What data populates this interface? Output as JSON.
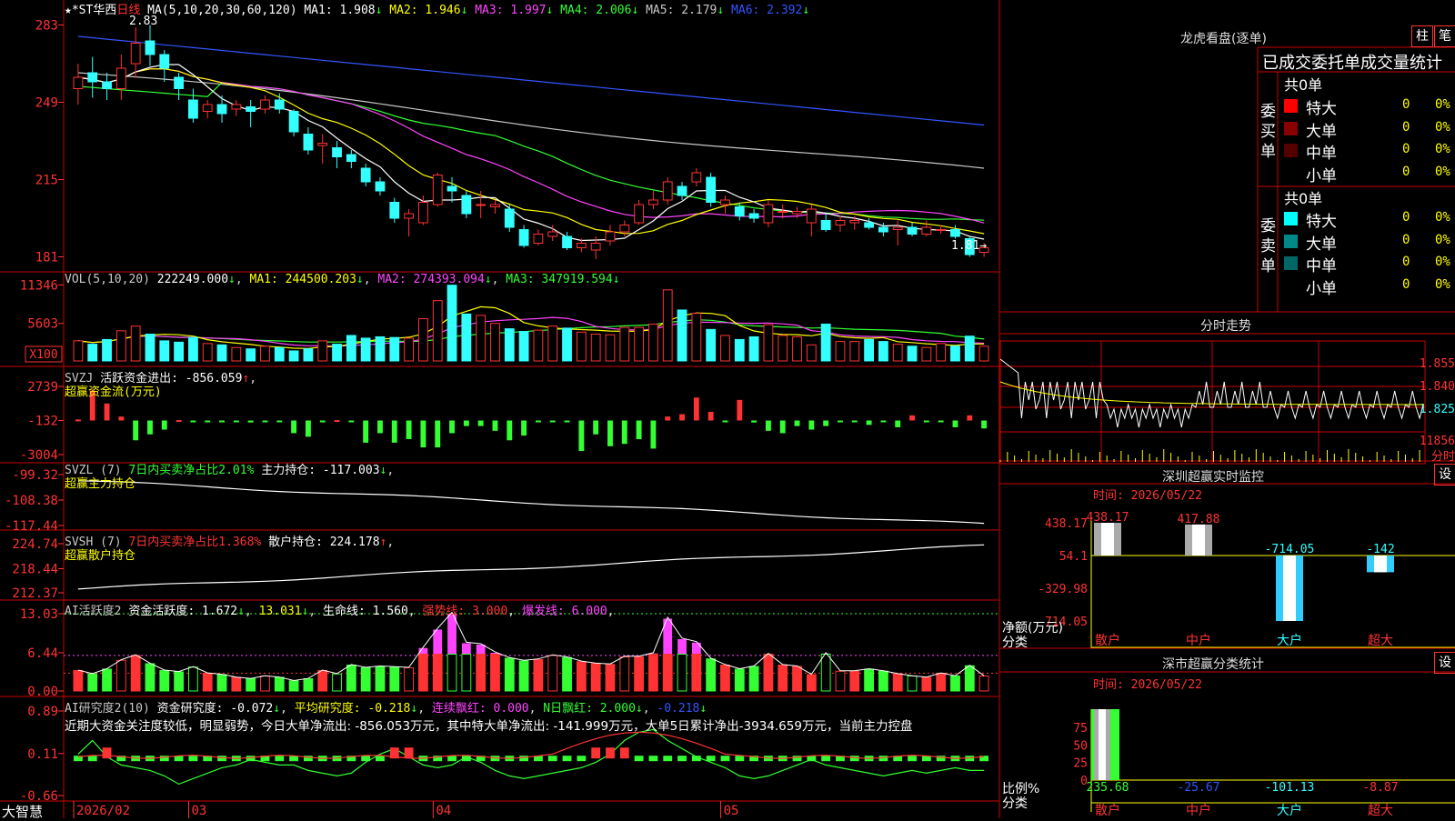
{
  "stock": {
    "name": "★*ST华西",
    "period": "日线",
    "ma_header": "MA(5,10,20,30,60,120)",
    "ma_values": [
      {
        "label": "MA1:",
        "value": "1.908",
        "arrow": "↓",
        "color": "#ffffff"
      },
      {
        "label": "MA2:",
        "value": "1.946",
        "arrow": "↓",
        "color": "#ffff00"
      },
      {
        "label": "MA3:",
        "value": "1.997",
        "arrow": "↓",
        "color": "#ff44ff"
      },
      {
        "label": "MA4:",
        "value": "2.006",
        "arrow": "↓",
        "color": "#33ff33"
      },
      {
        "label": "MA5:",
        "value": "2.179",
        "arrow": "↓",
        "color": "#c8c8c8"
      },
      {
        "label": "MA6:",
        "value": "2.392",
        "arrow": "↓",
        "color": "#3355ff"
      }
    ],
    "high_marker": "2.83",
    "low_marker": "1.81→",
    "price_ticks": [
      "283",
      "249",
      "215",
      "181"
    ]
  },
  "vol": {
    "header": "VOL(5,10,20)",
    "value": "222249.000",
    "ma1": "MA1: 244500.203",
    "ma2": "MA2: 274393.094",
    "ma3": "MA3: 347919.594",
    "ticks": [
      "11346",
      "5603",
      "X100"
    ]
  },
  "svzj": {
    "header": "SVZJ",
    "label": "活跃资金进出: -856.059",
    "sub": "超赢资金流(万元)",
    "ticks": [
      "2739",
      "-132",
      "-3004"
    ]
  },
  "svzl": {
    "header": "SVZL (7)",
    "text1": "7日内买卖净占比2.01%",
    "text2": "主力持仓: -117.003",
    "sub": "超赢主力持仓",
    "ticks": [
      "-99.32",
      "-108.38",
      "-117.44"
    ]
  },
  "svsh": {
    "header": "SVSH (7)",
    "text1": "7日内买卖净占比1.368%",
    "text2": "散户持仓: 224.178",
    "sub": "超赢散户持仓",
    "ticks": [
      "224.74",
      "218.44",
      "212.37"
    ]
  },
  "ai1": {
    "header": "AI活跃度2",
    "label": "资金活跃度: 1.672",
    "v1": "13.031",
    "v2": "生命线: 1.560",
    "v3": "强势线: 3.000",
    "v4": "爆发线: 6.000",
    "ticks": [
      "13.03",
      "6.44",
      "0.00"
    ]
  },
  "ai2": {
    "header": "AI研究度2(10)",
    "label": "资金研究度: -0.072",
    "avg": "平均研究度: -0.218",
    "cont": "连续飘红: 0.000",
    "nday": "N日飘红: 2.000",
    "last": "-0.218",
    "comment": "近期大资金关注度较低，明显弱势，今日大单净流出: -856.053万元，其中特大单净流出: -141.999万元，大单5日累计净出-3934.659万元，当前主力控盘",
    "ticks": [
      "0.89",
      "0.11",
      "-0.66"
    ]
  },
  "xaxis": {
    "labels": [
      "2026/02",
      "03",
      "04",
      "05"
    ]
  },
  "brand": "大智慧",
  "right": {
    "dragon_title": "龙虎看盘(逐单)",
    "btn1": "柱",
    "btn2": "笔",
    "subtitle": "已成交委托单成交量统计",
    "buy_side_label": "委买单",
    "sell_side_label": "委卖单",
    "buy_total": "共0单",
    "sell_total": "共0单",
    "buy_rows": [
      {
        "name": "特大",
        "value": "0",
        "pct": "0%",
        "color": "#ff0000"
      },
      {
        "name": "大单",
        "value": "0",
        "pct": "0%",
        "color": "#880000"
      },
      {
        "name": "中单",
        "value": "0",
        "pct": "0%",
        "color": "#550000"
      },
      {
        "name": "小单",
        "value": "0",
        "pct": "0%",
        "color": ""
      }
    ],
    "sell_rows": [
      {
        "name": "特大",
        "value": "0",
        "pct": "0%",
        "color": "#00ffff"
      },
      {
        "name": "大单",
        "value": "0",
        "pct": "0%",
        "color": "#008888"
      },
      {
        "name": "中单",
        "value": "0",
        "pct": "0%",
        "color": "#006666"
      },
      {
        "name": "小单",
        "value": "0",
        "pct": "0%",
        "color": ""
      }
    ],
    "intraday_title": "分时走势",
    "intraday_ticks": [
      "1.855",
      "1.840",
      "1.825",
      "11856",
      "分时"
    ],
    "sz_title": "深圳超赢实时监控",
    "sz_btn": "设",
    "sz_time": "时间: 2026/05/22",
    "sz_ticks": [
      "438.17",
      "54.1",
      "-329.98",
      "-714.05"
    ],
    "sz_unit": "净额(万元)",
    "sz_cat_label": "分类",
    "sz_bars": [
      {
        "cat": "散户",
        "value": 438.17,
        "label": "438.17",
        "lcolor": "#ff3333"
      },
      {
        "cat": "中户",
        "value": 417.88,
        "label": "417.88",
        "lcolor": "#ff3333"
      },
      {
        "cat": "大户",
        "value": -714.05,
        "label": "-714.05",
        "lcolor": "#33ffff"
      },
      {
        "cat": "超大",
        "value": -142,
        "label": "-142",
        "lcolor": "#33ffff"
      }
    ],
    "sc_title": "深市超赢分类统计",
    "sc_btn": "设",
    "sc_time": "时间: 2026/05/22",
    "sc_ticks": [
      "75",
      "50",
      "25",
      "0"
    ],
    "sc_unit": "比例%",
    "sc_cat_label": "分类",
    "sc_bars": [
      {
        "cat": "散户",
        "value": 235.68,
        "label": "235.68",
        "lcolor": "#33ff33"
      },
      {
        "cat": "中户",
        "value": -25.67,
        "label": "-25.67",
        "lcolor": "#3355ff"
      },
      {
        "cat": "大户",
        "value": -101.13,
        "label": "-101.13",
        "lcolor": "#33ffff"
      },
      {
        "cat": "超大",
        "value": -8.87,
        "label": "-8.87",
        "lcolor": "#ff3333"
      }
    ],
    "cat_colors": [
      "#ff3333",
      "#ff3333",
      "#33ffff",
      "#ff3333"
    ]
  },
  "chart_data": {
    "type": "bar",
    "title": "★*ST华西 日线",
    "price_axis_ticks": [
      283,
      249,
      215,
      181
    ],
    "ohlc": [
      {
        "o": 2.55,
        "c": 2.6,
        "h": 2.66,
        "l": 2.48
      },
      {
        "o": 2.62,
        "c": 2.58,
        "h": 2.69,
        "l": 2.51
      },
      {
        "o": 2.58,
        "c": 2.55,
        "h": 2.62,
        "l": 2.5
      },
      {
        "o": 2.55,
        "c": 2.64,
        "h": 2.7,
        "l": 2.5
      },
      {
        "o": 2.66,
        "c": 2.75,
        "h": 2.82,
        "l": 2.6
      },
      {
        "o": 2.76,
        "c": 2.7,
        "h": 2.83,
        "l": 2.65
      },
      {
        "o": 2.7,
        "c": 2.64,
        "h": 2.72,
        "l": 2.58
      },
      {
        "o": 2.6,
        "c": 2.55,
        "h": 2.62,
        "l": 2.5
      },
      {
        "o": 2.5,
        "c": 2.42,
        "h": 2.55,
        "l": 2.4
      },
      {
        "o": 2.45,
        "c": 2.48,
        "h": 2.5,
        "l": 2.42
      },
      {
        "o": 2.48,
        "c": 2.44,
        "h": 2.52,
        "l": 2.4
      },
      {
        "o": 2.46,
        "c": 2.48,
        "h": 2.5,
        "l": 2.43
      },
      {
        "o": 2.47,
        "c": 2.45,
        "h": 2.5,
        "l": 2.38
      },
      {
        "o": 2.46,
        "c": 2.5,
        "h": 2.52,
        "l": 2.44
      },
      {
        "o": 2.5,
        "c": 2.46,
        "h": 2.53,
        "l": 2.44
      },
      {
        "o": 2.45,
        "c": 2.36,
        "h": 2.46,
        "l": 2.34
      },
      {
        "o": 2.35,
        "c": 2.28,
        "h": 2.38,
        "l": 2.26
      },
      {
        "o": 2.3,
        "c": 2.31,
        "h": 2.35,
        "l": 2.22
      },
      {
        "o": 2.29,
        "c": 2.25,
        "h": 2.32,
        "l": 2.2
      },
      {
        "o": 2.26,
        "c": 2.23,
        "h": 2.28,
        "l": 2.2
      },
      {
        "o": 2.2,
        "c": 2.14,
        "h": 2.22,
        "l": 2.12
      },
      {
        "o": 2.14,
        "c": 2.1,
        "h": 2.16,
        "l": 2.08
      },
      {
        "o": 2.05,
        "c": 1.98,
        "h": 2.07,
        "l": 1.96
      },
      {
        "o": 1.98,
        "c": 2.0,
        "h": 2.02,
        "l": 1.9
      },
      {
        "o": 1.96,
        "c": 2.05,
        "h": 2.08,
        "l": 1.95
      },
      {
        "o": 2.04,
        "c": 2.17,
        "h": 2.18,
        "l": 2.03
      },
      {
        "o": 2.12,
        "c": 2.1,
        "h": 2.16,
        "l": 2.05
      },
      {
        "o": 2.08,
        "c": 2.0,
        "h": 2.1,
        "l": 1.98
      },
      {
        "o": 2.04,
        "c": 2.04,
        "h": 2.1,
        "l": 1.98
      },
      {
        "o": 2.03,
        "c": 2.04,
        "h": 2.06,
        "l": 2.0
      },
      {
        "o": 2.02,
        "c": 1.94,
        "h": 2.04,
        "l": 1.92
      },
      {
        "o": 1.93,
        "c": 1.86,
        "h": 1.95,
        "l": 1.85
      },
      {
        "o": 1.87,
        "c": 1.91,
        "h": 1.93,
        "l": 1.86
      },
      {
        "o": 1.9,
        "c": 1.92,
        "h": 1.95,
        "l": 1.88
      },
      {
        "o": 1.9,
        "c": 1.85,
        "h": 1.92,
        "l": 1.84
      },
      {
        "o": 1.85,
        "c": 1.87,
        "h": 1.89,
        "l": 1.83
      },
      {
        "o": 1.84,
        "c": 1.87,
        "h": 1.9,
        "l": 1.8
      },
      {
        "o": 1.88,
        "c": 1.92,
        "h": 1.95,
        "l": 1.86
      },
      {
        "o": 1.92,
        "c": 1.95,
        "h": 1.97,
        "l": 1.9
      },
      {
        "o": 1.96,
        "c": 2.04,
        "h": 2.06,
        "l": 1.95
      },
      {
        "o": 2.04,
        "c": 2.06,
        "h": 2.1,
        "l": 2.02
      },
      {
        "o": 2.06,
        "c": 2.14,
        "h": 2.16,
        "l": 2.04
      },
      {
        "o": 2.12,
        "c": 2.08,
        "h": 2.14,
        "l": 2.06
      },
      {
        "o": 2.14,
        "c": 2.18,
        "h": 2.2,
        "l": 2.12
      },
      {
        "o": 2.16,
        "c": 2.05,
        "h": 2.18,
        "l": 2.03
      },
      {
        "o": 2.04,
        "c": 2.06,
        "h": 2.08,
        "l": 2.0
      },
      {
        "o": 2.03,
        "c": 1.99,
        "h": 2.05,
        "l": 1.97
      },
      {
        "o": 2.0,
        "c": 1.98,
        "h": 2.02,
        "l": 1.96
      },
      {
        "o": 1.96,
        "c": 2.04,
        "h": 2.06,
        "l": 1.94
      },
      {
        "o": 2.01,
        "c": 2.01,
        "h": 2.04,
        "l": 1.98
      },
      {
        "o": 2.0,
        "c": 2.01,
        "h": 2.03,
        "l": 1.98
      },
      {
        "o": 1.96,
        "c": 2.02,
        "h": 2.04,
        "l": 1.9
      },
      {
        "o": 1.97,
        "c": 1.93,
        "h": 2.0,
        "l": 1.92
      },
      {
        "o": 1.95,
        "c": 1.97,
        "h": 1.99,
        "l": 1.92
      },
      {
        "o": 1.96,
        "c": 1.97,
        "h": 1.99,
        "l": 1.93
      },
      {
        "o": 1.96,
        "c": 1.94,
        "h": 1.98,
        "l": 1.93
      },
      {
        "o": 1.94,
        "c": 1.92,
        "h": 1.96,
        "l": 1.9
      },
      {
        "o": 1.93,
        "c": 1.94,
        "h": 1.97,
        "l": 1.86
      },
      {
        "o": 1.94,
        "c": 1.91,
        "h": 1.96,
        "l": 1.9
      },
      {
        "o": 1.91,
        "c": 1.94,
        "h": 1.97,
        "l": 1.9
      },
      {
        "o": 1.93,
        "c": 1.93,
        "h": 1.95,
        "l": 1.91
      },
      {
        "o": 1.93,
        "c": 1.9,
        "h": 1.95,
        "l": 1.89
      },
      {
        "o": 1.89,
        "c": 1.82,
        "h": 1.9,
        "l": 1.81
      },
      {
        "o": 1.83,
        "c": 1.85,
        "h": 1.87,
        "l": 1.81
      }
    ],
    "volume": [
      3.0,
      2.5,
      3.2,
      4.5,
      5.2,
      4.0,
      3.0,
      2.8,
      3.5,
      2.6,
      2.4,
      2.0,
      1.8,
      2.2,
      2.0,
      1.5,
      1.8,
      3.0,
      2.5,
      3.8,
      3.4,
      3.6,
      3.5,
      3.4,
      6.3,
      9.0,
      11.3,
      7.0,
      6.8,
      5.6,
      4.8,
      4.4,
      4.6,
      5.2,
      4.9,
      4.3,
      4.0,
      3.9,
      5.0,
      5.0,
      5.5,
      10.6,
      7.6,
      7.1,
      4.7,
      3.8,
      3.2,
      3.6,
      5.4,
      3.8,
      3.6,
      2.4,
      5.5,
      2.9,
      2.9,
      3.2,
      2.9,
      2.5,
      2.2,
      2.0,
      2.6,
      2.2,
      3.7,
      2.2
    ],
    "svzj": [
      -50,
      2400,
      1300,
      200,
      -1800,
      -1300,
      -900,
      -100,
      -200,
      -250,
      -200,
      -150,
      -300,
      -200,
      -180,
      -1200,
      -1500,
      -200,
      -100,
      -150,
      -2000,
      -1200,
      -2000,
      -1700,
      -2400,
      -2400,
      -1200,
      -600,
      -600,
      -1000,
      -1800,
      -1400,
      -150,
      -150,
      -150,
      -2700,
      -1300,
      -2300,
      -2100,
      -1700,
      -2500,
      200,
      400,
      1800,
      600,
      -150,
      1600,
      -300,
      -1000,
      -1200,
      -600,
      -900,
      -600,
      -200,
      -200,
      -500,
      -200,
      -700,
      300,
      -200,
      -250,
      -700,
      300,
      -800,
      -800,
      -700,
      -600,
      -200,
      -1100,
      -800
    ],
    "ai1_life": 1.56,
    "ai1_strong": 3.0,
    "ai1_burst": 6.0,
    "ai1_top": 13.031
  }
}
